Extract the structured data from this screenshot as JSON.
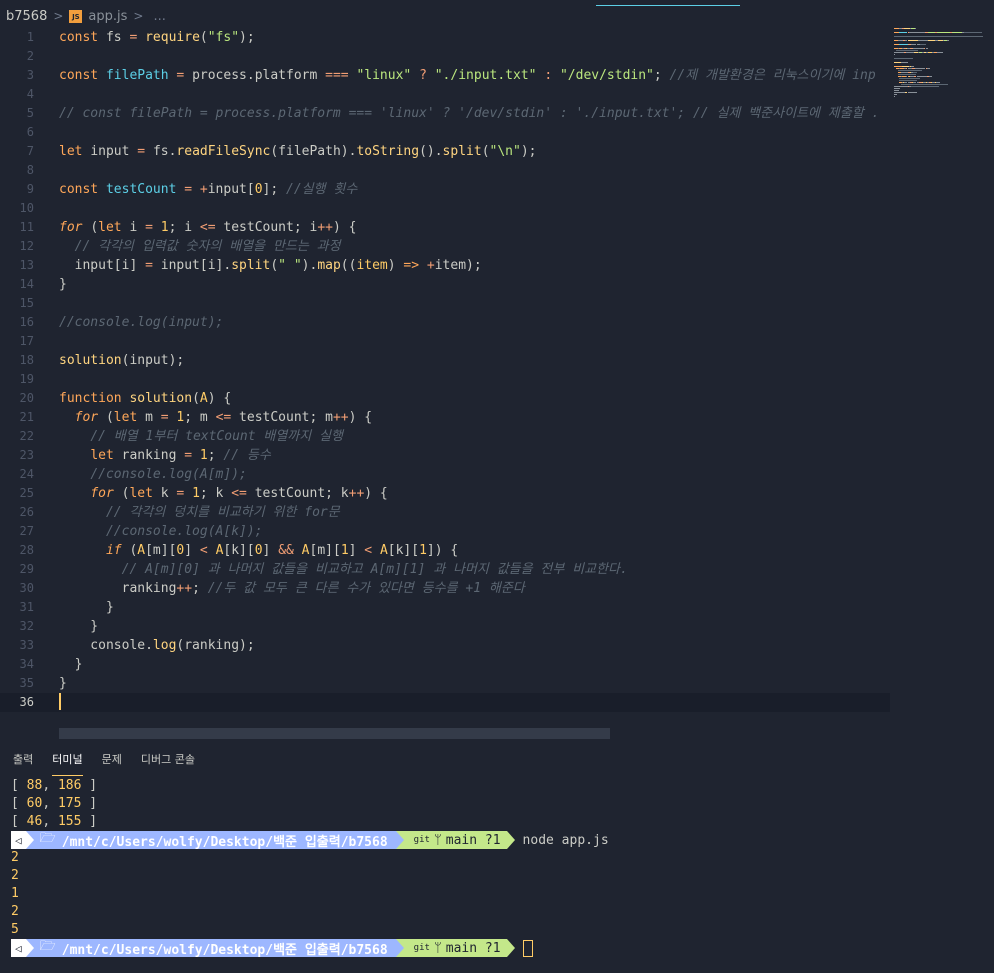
{
  "breadcrumb": {
    "folder": "b7568",
    "file_badge": "JS",
    "file": "app.js",
    "more": "..."
  },
  "editor": {
    "lines": [
      {
        "n": "1",
        "tokens": [
          [
            "kw",
            "const "
          ],
          [
            "var",
            "fs "
          ],
          [
            "op",
            "= "
          ],
          [
            "fn",
            "require"
          ],
          [
            "var",
            "("
          ],
          [
            "str",
            "\"fs\""
          ],
          [
            "var",
            ");"
          ]
        ]
      },
      {
        "n": "2",
        "tokens": []
      },
      {
        "n": "3",
        "tokens": [
          [
            "kw",
            "const "
          ],
          [
            "prop",
            "filePath "
          ],
          [
            "op",
            "= "
          ],
          [
            "var",
            "process.platform "
          ],
          [
            "op",
            "=== "
          ],
          [
            "str",
            "\"linux\" "
          ],
          [
            "op",
            "? "
          ],
          [
            "str",
            "\"./input.txt\" "
          ],
          [
            "op",
            ": "
          ],
          [
            "str",
            "\"/dev/stdin\""
          ],
          [
            "var",
            "; "
          ],
          [
            "cm",
            "//제 개발환경은 리눅스이기에 inp"
          ]
        ]
      },
      {
        "n": "4",
        "tokens": []
      },
      {
        "n": "5",
        "tokens": [
          [
            "cm",
            "// const filePath = process.platform === 'linux' ? '/dev/stdin' : './input.txt'; // 실제 백준사이트에 제출할 ."
          ]
        ]
      },
      {
        "n": "6",
        "tokens": []
      },
      {
        "n": "7",
        "tokens": [
          [
            "kw",
            "let "
          ],
          [
            "var",
            "input "
          ],
          [
            "op",
            "= "
          ],
          [
            "var",
            "fs."
          ],
          [
            "fn",
            "readFileSync"
          ],
          [
            "var",
            "(filePath)."
          ],
          [
            "fn",
            "toString"
          ],
          [
            "var",
            "()."
          ],
          [
            "fn",
            "split"
          ],
          [
            "var",
            "("
          ],
          [
            "str",
            "\"\\n\""
          ],
          [
            "var",
            ");"
          ]
        ]
      },
      {
        "n": "8",
        "tokens": []
      },
      {
        "n": "9",
        "tokens": [
          [
            "kw",
            "const "
          ],
          [
            "prop",
            "testCount "
          ],
          [
            "op",
            "= +"
          ],
          [
            "var",
            "input["
          ],
          [
            "num",
            "0"
          ],
          [
            "var",
            "]; "
          ],
          [
            "cm",
            "//실행 횟수"
          ]
        ]
      },
      {
        "n": "10",
        "tokens": []
      },
      {
        "n": "11",
        "tokens": [
          [
            "kwi",
            "for "
          ],
          [
            "var",
            "("
          ],
          [
            "kw",
            "let "
          ],
          [
            "var",
            "i "
          ],
          [
            "op",
            "= "
          ],
          [
            "num",
            "1"
          ],
          [
            "var",
            "; i "
          ],
          [
            "op",
            "<= "
          ],
          [
            "var",
            "testCount; i"
          ],
          [
            "op",
            "++"
          ],
          [
            "var",
            ") {"
          ]
        ]
      },
      {
        "n": "12",
        "tokens": [
          [
            "var",
            "  "
          ],
          [
            "cm",
            "// 각각의 입력값 숫자의 배열을 만드는 과정"
          ]
        ]
      },
      {
        "n": "13",
        "tokens": [
          [
            "var",
            "  input[i] "
          ],
          [
            "op",
            "= "
          ],
          [
            "var",
            "input[i]."
          ],
          [
            "fn",
            "split"
          ],
          [
            "var",
            "("
          ],
          [
            "str",
            "\" \""
          ],
          [
            "var",
            ")."
          ],
          [
            "fn",
            "map"
          ],
          [
            "var",
            "(("
          ],
          [
            "param",
            "item"
          ],
          [
            "var",
            ") "
          ],
          [
            "kw",
            "=> "
          ],
          [
            "op",
            "+"
          ],
          [
            "var",
            "item);"
          ]
        ]
      },
      {
        "n": "14",
        "tokens": [
          [
            "var",
            "}"
          ]
        ]
      },
      {
        "n": "15",
        "tokens": []
      },
      {
        "n": "16",
        "tokens": [
          [
            "cm",
            "//console.log(input);"
          ]
        ]
      },
      {
        "n": "17",
        "tokens": []
      },
      {
        "n": "18",
        "tokens": [
          [
            "fn",
            "solution"
          ],
          [
            "var",
            "(input);"
          ]
        ]
      },
      {
        "n": "19",
        "tokens": []
      },
      {
        "n": "20",
        "tokens": [
          [
            "kw",
            "function "
          ],
          [
            "fn",
            "solution"
          ],
          [
            "var",
            "("
          ],
          [
            "param",
            "A"
          ],
          [
            "var",
            ") {"
          ]
        ]
      },
      {
        "n": "21",
        "tokens": [
          [
            "var",
            "  "
          ],
          [
            "kwi",
            "for "
          ],
          [
            "var",
            "("
          ],
          [
            "kw",
            "let "
          ],
          [
            "var",
            "m "
          ],
          [
            "op",
            "= "
          ],
          [
            "num",
            "1"
          ],
          [
            "var",
            "; m "
          ],
          [
            "op",
            "<= "
          ],
          [
            "var",
            "testCount; m"
          ],
          [
            "op",
            "++"
          ],
          [
            "var",
            ") {"
          ]
        ]
      },
      {
        "n": "22",
        "tokens": [
          [
            "var",
            "    "
          ],
          [
            "cm",
            "// 배열 1부터 textCount 배열까지 실행"
          ]
        ]
      },
      {
        "n": "23",
        "tokens": [
          [
            "var",
            "    "
          ],
          [
            "kw",
            "let "
          ],
          [
            "var",
            "ranking "
          ],
          [
            "op",
            "= "
          ],
          [
            "num",
            "1"
          ],
          [
            "var",
            "; "
          ],
          [
            "cm",
            "// 등수"
          ]
        ]
      },
      {
        "n": "24",
        "tokens": [
          [
            "var",
            "    "
          ],
          [
            "cm",
            "//console.log(A[m]);"
          ]
        ]
      },
      {
        "n": "25",
        "tokens": [
          [
            "var",
            "    "
          ],
          [
            "kwi",
            "for "
          ],
          [
            "var",
            "("
          ],
          [
            "kw",
            "let "
          ],
          [
            "var",
            "k "
          ],
          [
            "op",
            "= "
          ],
          [
            "num",
            "1"
          ],
          [
            "var",
            "; k "
          ],
          [
            "op",
            "<= "
          ],
          [
            "var",
            "testCount; k"
          ],
          [
            "op",
            "++"
          ],
          [
            "var",
            ") {"
          ]
        ]
      },
      {
        "n": "26",
        "tokens": [
          [
            "var",
            "      "
          ],
          [
            "cm",
            "// 각각의 덩치를 비교하기 위한 for문"
          ]
        ]
      },
      {
        "n": "27",
        "tokens": [
          [
            "var",
            "      "
          ],
          [
            "cm",
            "//console.log(A[k]);"
          ]
        ]
      },
      {
        "n": "28",
        "tokens": [
          [
            "var",
            "      "
          ],
          [
            "kwi",
            "if "
          ],
          [
            "var",
            "("
          ],
          [
            "param",
            "A"
          ],
          [
            "var",
            "[m]["
          ],
          [
            "num",
            "0"
          ],
          [
            "var",
            "] "
          ],
          [
            "op",
            "< "
          ],
          [
            "param",
            "A"
          ],
          [
            "var",
            "[k]["
          ],
          [
            "num",
            "0"
          ],
          [
            "var",
            "] "
          ],
          [
            "op",
            "&& "
          ],
          [
            "param",
            "A"
          ],
          [
            "var",
            "[m]["
          ],
          [
            "num",
            "1"
          ],
          [
            "var",
            "] "
          ],
          [
            "op",
            "< "
          ],
          [
            "param",
            "A"
          ],
          [
            "var",
            "[k]["
          ],
          [
            "num",
            "1"
          ],
          [
            "var",
            "]) {"
          ]
        ]
      },
      {
        "n": "29",
        "tokens": [
          [
            "var",
            "        "
          ],
          [
            "cm",
            "// A[m][0] 과 나머지 값들을 비교하고 A[m][1] 과 나머지 값들을 전부 비교한다."
          ]
        ]
      },
      {
        "n": "30",
        "tokens": [
          [
            "var",
            "        ranking"
          ],
          [
            "op",
            "++"
          ],
          [
            "var",
            "; "
          ],
          [
            "cm",
            "//두 값 모두 큰 다른 수가 있다면 등수를 +1 해준다"
          ]
        ]
      },
      {
        "n": "31",
        "tokens": [
          [
            "var",
            "      }"
          ]
        ]
      },
      {
        "n": "32",
        "tokens": [
          [
            "var",
            "    }"
          ]
        ]
      },
      {
        "n": "33",
        "tokens": [
          [
            "var",
            "    console."
          ],
          [
            "fn",
            "log"
          ],
          [
            "var",
            "(ranking);"
          ]
        ]
      },
      {
        "n": "34",
        "tokens": [
          [
            "var",
            "  }"
          ]
        ]
      },
      {
        "n": "35",
        "tokens": [
          [
            "var",
            "}"
          ]
        ]
      },
      {
        "n": "36",
        "tokens": []
      }
    ]
  },
  "panel": {
    "tabs": [
      "출력",
      "터미널",
      "문제",
      "디버그 콘솔"
    ],
    "active_tab": "터미널"
  },
  "terminal": {
    "array_lines": [
      [
        "88",
        "186"
      ],
      [
        "60",
        "175"
      ],
      [
        "46",
        "155"
      ]
    ],
    "prompt": {
      "arrow": "◁",
      "folder_glyph": "🗁",
      "path": "/mnt/c/Users/wolfy/Desktop/백준 입출력/b7568",
      "git_label": "git",
      "branch_glyph": "ᛘ",
      "branch": "main ?1"
    },
    "command": "node app.js",
    "output": [
      "2",
      "2",
      "1",
      "2",
      "5"
    ]
  },
  "colors": {
    "background": "#1f2430",
    "keyword": "#ffa759",
    "string": "#bae67e",
    "function": "#ffd580",
    "comment": "#5c6773",
    "number": "#ffcc66",
    "prompt_path_bg": "#9db7ff",
    "prompt_git_bg": "#c4e88a"
  }
}
